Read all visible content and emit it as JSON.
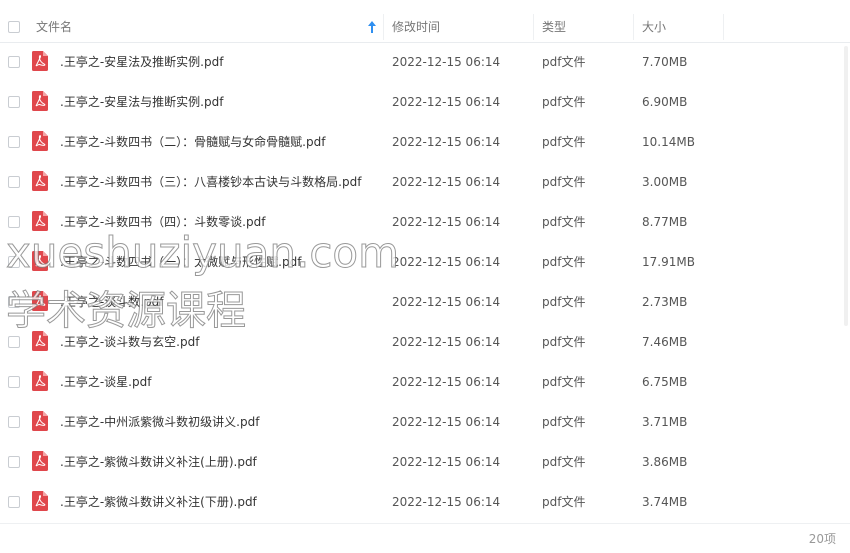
{
  "header": {
    "name_label": "文件名",
    "date_label": "修改时间",
    "type_label": "类型",
    "size_label": "大小"
  },
  "files": [
    {
      "name": ".王亭之-安星法及推断实例.pdf",
      "date": "2022-12-15 06:14",
      "type": "pdf文件",
      "size": "7.70MB"
    },
    {
      "name": ".王亭之-安星法与推断实例.pdf",
      "date": "2022-12-15 06:14",
      "type": "pdf文件",
      "size": "6.90MB"
    },
    {
      "name": ".王亭之-斗数四书（二）：骨髓赋与女命骨髓赋.pdf",
      "date": "2022-12-15 06:14",
      "type": "pdf文件",
      "size": "10.14MB"
    },
    {
      "name": ".王亭之-斗数四书（三）：八喜楼钞本古诀与斗数格局.pdf",
      "date": "2022-12-15 06:14",
      "type": "pdf文件",
      "size": "3.00MB"
    },
    {
      "name": ".王亭之-斗数四书（四）：斗数零谈.pdf",
      "date": "2022-12-15 06:14",
      "type": "pdf文件",
      "size": "8.77MB"
    },
    {
      "name": ".王亭之-斗数四书（一）：太微赋与形性赋.pdf",
      "date": "2022-12-15 06:14",
      "type": "pdf文件",
      "size": "17.91MB"
    },
    {
      "name": ".王亭之-谈斗数.pdf",
      "date": "2022-12-15 06:14",
      "type": "pdf文件",
      "size": "2.73MB"
    },
    {
      "name": ".王亭之-谈斗数与玄空.pdf",
      "date": "2022-12-15 06:14",
      "type": "pdf文件",
      "size": "7.46MB"
    },
    {
      "name": ".王亭之-谈星.pdf",
      "date": "2022-12-15 06:14",
      "type": "pdf文件",
      "size": "6.75MB"
    },
    {
      "name": ".王亭之-中州派紫微斗数初级讲义.pdf",
      "date": "2022-12-15 06:14",
      "type": "pdf文件",
      "size": "3.71MB"
    },
    {
      "name": ".王亭之-紫微斗数讲义补注(上册).pdf",
      "date": "2022-12-15 06:14",
      "type": "pdf文件",
      "size": "3.86MB"
    },
    {
      "name": ".王亭之-紫微斗数讲义补注(下册).pdf",
      "date": "2022-12-15 06:14",
      "type": "pdf文件",
      "size": "3.74MB"
    }
  ],
  "footer": {
    "count": "20项"
  },
  "watermark": {
    "line1": "xueshuziyuan.com",
    "line2": "学术资源课程"
  },
  "colors": {
    "pdf_icon": "#e0474c",
    "sort_arrow": "#2f8ff0",
    "header_text": "#777777",
    "row_text": "#333333"
  },
  "icons": {
    "file_icon": "pdf-file-icon",
    "sort_icon": "sort-ascending-icon"
  }
}
